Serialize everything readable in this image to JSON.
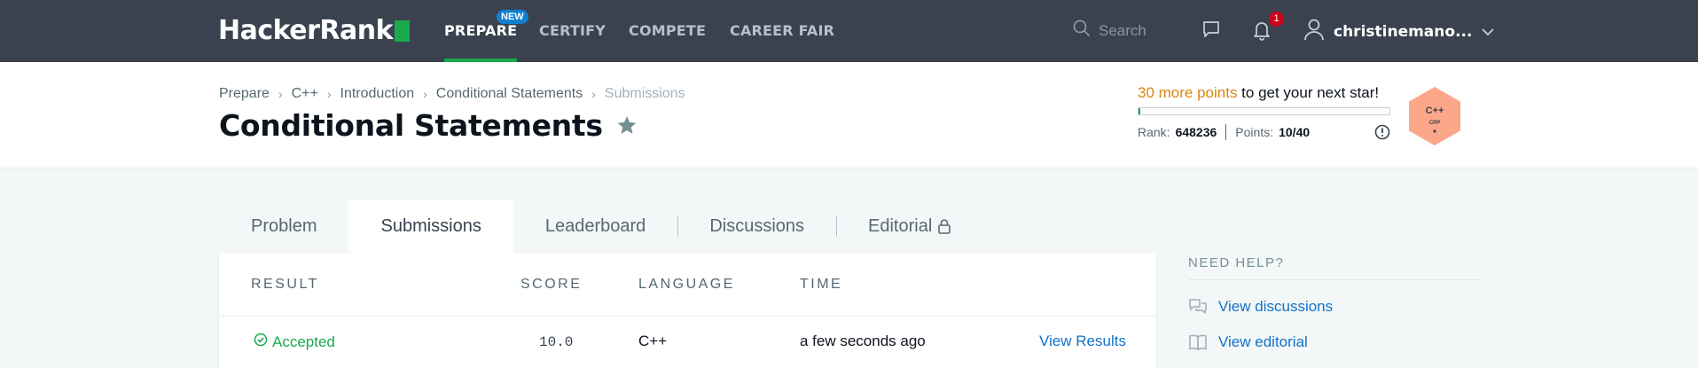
{
  "nav": {
    "logo_text": "HackerRank",
    "items": [
      {
        "label": "PREPARE",
        "active": true
      },
      {
        "label": "CERTIFY"
      },
      {
        "label": "COMPETE"
      },
      {
        "label": "CAREER FAIR"
      }
    ],
    "new_badge": "NEW",
    "search_placeholder": "Search",
    "notification_count": "1",
    "username": "christinemano..."
  },
  "breadcrumb": [
    "Prepare",
    "C++",
    "Introduction",
    "Conditional Statements",
    "Submissions"
  ],
  "page_title": "Conditional Statements",
  "stars": {
    "points_needed": "30 more points",
    "message_rest": " to get your next star!",
    "progress_fraction": 0.0,
    "rank_label": "Rank:",
    "rank_value": "648236",
    "points_label": "Points:",
    "points_value": "10/40",
    "badge_line1": "C++",
    "badge_line2": "CPP",
    "badge_color": "#fca78a"
  },
  "tabs": [
    {
      "label": "Problem"
    },
    {
      "label": "Submissions",
      "active": true
    },
    {
      "label": "Leaderboard"
    },
    {
      "label": "Discussions"
    },
    {
      "label": "Editorial",
      "locked": true
    }
  ],
  "table": {
    "headers": [
      "RESULT",
      "SCORE",
      "LANGUAGE",
      "TIME"
    ],
    "rows": [
      {
        "result": "Accepted",
        "score": "10.0",
        "language": "C++",
        "time": "a few seconds ago",
        "action": "View Results"
      }
    ]
  },
  "help": {
    "title": "NEED HELP?",
    "links": [
      {
        "label": "View discussions",
        "icon": "discussions-icon"
      },
      {
        "label": "View editorial",
        "icon": "book-icon"
      }
    ]
  },
  "colors": {
    "nav_bg": "#39424e",
    "accent_green": "#1ba94c",
    "link_blue": "#1172c9",
    "highlight_orange": "#d8860e"
  }
}
